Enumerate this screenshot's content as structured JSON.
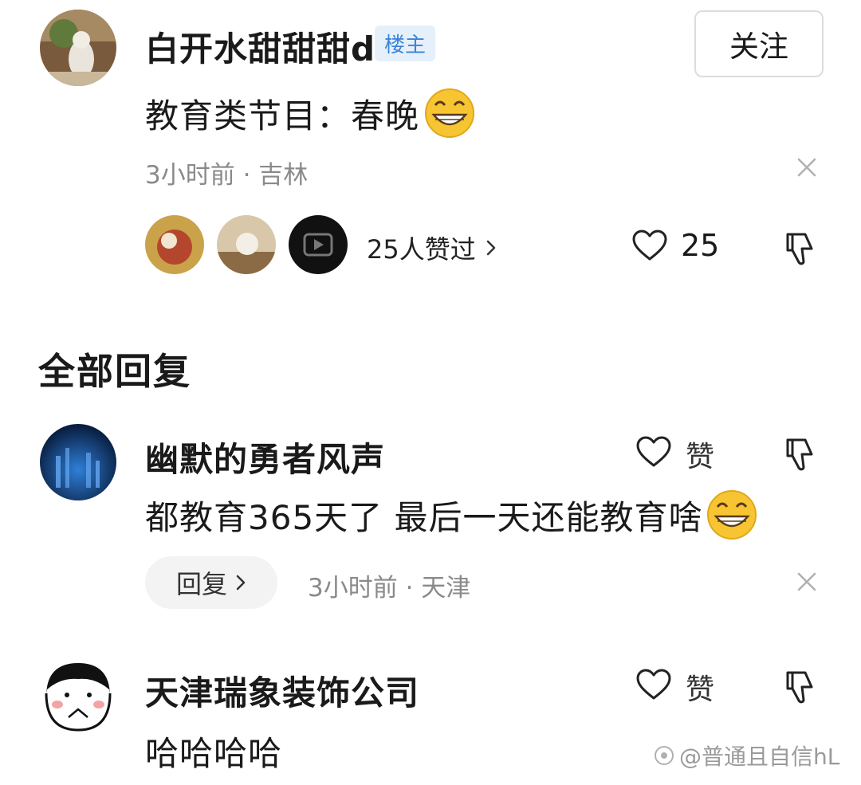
{
  "top_comment": {
    "author": "白开水甜甜甜d",
    "badge": "楼主",
    "follow_label": "关注",
    "text": "教育类节目：春晚",
    "meta": "3小时前 · 吉林",
    "likers_text": "25人赞过",
    "like_count": "25",
    "icons": [
      "grin-emoji",
      "close-icon",
      "heart-icon",
      "thumbs-down-icon",
      "chevron-right-icon"
    ]
  },
  "section": {
    "title": "全部回复"
  },
  "replies": [
    {
      "author": "幽默的勇者风声",
      "like_label": "赞",
      "text": "都教育365天了 最后一天还能教育啥",
      "reply_label": "回复",
      "meta": "3小时前 · 天津"
    },
    {
      "author": "天津瑞象装饰公司",
      "like_label": "赞",
      "text": "哈哈哈哈"
    }
  ],
  "watermark": "@普通且自信hL",
  "colors": {
    "badge_bg": "#e6f0fb",
    "badge_text": "#3a84d8",
    "meta_gray": "#8a8a8a",
    "emoji_yellow": "#f7c531"
  }
}
